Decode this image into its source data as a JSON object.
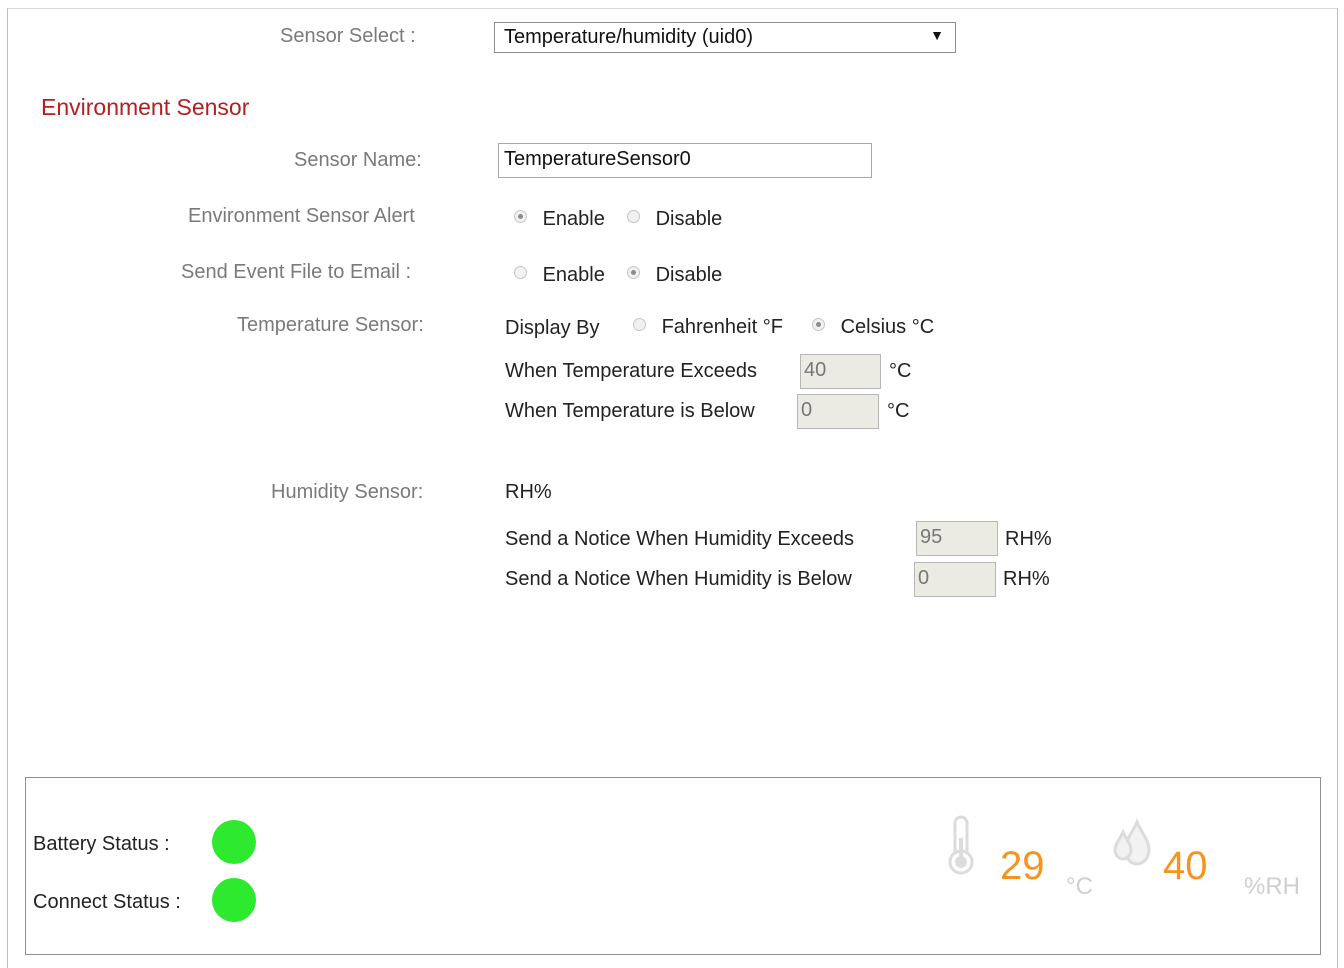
{
  "sensor_select": {
    "label": "Sensor Select :",
    "selected": "Temperature/humidity (uid0)"
  },
  "section_title": "Environment Sensor",
  "sensor_name": {
    "label": "Sensor Name:",
    "value": "TemperatureSensor0"
  },
  "env_alert": {
    "label": "Environment Sensor Alert",
    "options": [
      "Enable",
      "Disable"
    ],
    "selected": "Enable"
  },
  "send_event": {
    "label": "Send Event File to Email :",
    "options": [
      "Enable",
      "Disable"
    ],
    "selected": "Disable"
  },
  "temperature": {
    "label": "Temperature Sensor:",
    "display_by": "Display By",
    "options": [
      "Fahrenheit °F",
      "Celsius °C"
    ],
    "selected": "Celsius °C",
    "exceeds_label": "When Temperature Exceeds",
    "exceeds_value": "40",
    "below_label": "When Temperature is Below",
    "below_value": "0",
    "unit": "°C"
  },
  "humidity": {
    "label": "Humidity Sensor:",
    "unit_heading": "RH%",
    "exceeds_label": "Send a Notice When Humidity Exceeds",
    "exceeds_value": "95",
    "below_label": "Send a Notice When Humidity is Below",
    "below_value": "0",
    "unit": "RH%"
  },
  "status": {
    "battery_label": "Battery Status :",
    "connect_label": "Connect Status :",
    "battery_color": "#2eea2e",
    "connect_color": "#2eea2e",
    "temperature_value": "29",
    "temperature_unit": "°C",
    "humidity_value": "40",
    "humidity_unit": "%RH",
    "temperature_icon": "thermometer-icon",
    "humidity_icon": "water-drops-icon"
  }
}
